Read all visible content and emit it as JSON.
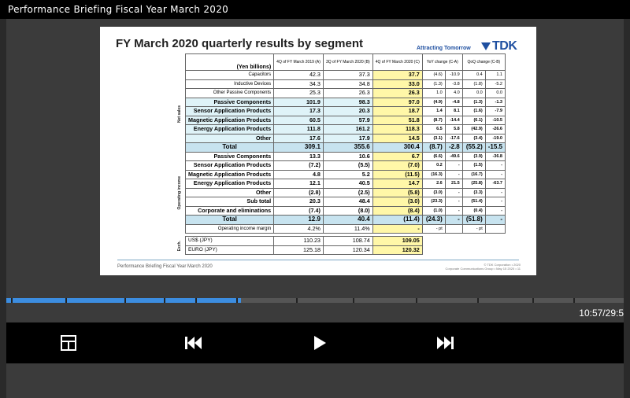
{
  "window": {
    "title": "Performance Briefing Fiscal Year March 2020"
  },
  "slide": {
    "title": "FY March 2020 quarterly results by segment",
    "tagline": "Attracting Tomorrow",
    "logo": "TDK",
    "footer_left": "Performance Briefing Fiscal Year March 2020",
    "footer_right_1": "© TDK Corporation • 2020",
    "footer_right_2": "Corporate Communications Group • May 15 2020 • 11",
    "section_net_sales": "Net sales",
    "section_operating_income": "Operating income",
    "section_fx": "Exch.",
    "table": {
      "unit": "(Yen billions)",
      "col_a": "4Q of FY March 2019 (A)",
      "col_b": "3Q of FY March 2020 (B)",
      "col_c": "4Q of FY March 2020 (C)",
      "yoy": "YoY change (C-A)",
      "qoq": "QoQ change (C-B)",
      "yen_billions": "Yen billions",
      "pct": "%",
      "rows": [
        {
          "label": "Capacitors",
          "a": "42.3",
          "b": "37.3",
          "c": "37.7",
          "yoy": "(4.6)",
          "yoy_pct": "-10.9",
          "qoq": "0.4",
          "qoq_pct": "1.1"
        },
        {
          "label": "Inductive Devices",
          "a": "34.3",
          "b": "34.8",
          "c": "33.0",
          "yoy": "(1.3)",
          "yoy_pct": "-3.8",
          "qoq": "(1.8)",
          "qoq_pct": "-5.2"
        },
        {
          "label": "Other Passive Components",
          "a": "25.3",
          "b": "26.3",
          "c": "26.3",
          "yoy": "1.0",
          "yoy_pct": "4.0",
          "qoq": "0.0",
          "qoq_pct": "0.0"
        },
        {
          "label": "Passive Components",
          "a": "101.9",
          "b": "98.3",
          "c": "97.0",
          "yoy": "(4.9)",
          "yoy_pct": "-4.8",
          "qoq": "(1.3)",
          "qoq_pct": "-1.3"
        },
        {
          "label": "Sensor Application Products",
          "a": "17.3",
          "b": "20.3",
          "c": "18.7",
          "yoy": "1.4",
          "yoy_pct": "8.1",
          "qoq": "(1.6)",
          "qoq_pct": "-7.9"
        },
        {
          "label": "Magnetic Application Products",
          "a": "60.5",
          "b": "57.9",
          "c": "51.8",
          "yoy": "(8.7)",
          "yoy_pct": "-14.4",
          "qoq": "(6.1)",
          "qoq_pct": "-10.5"
        },
        {
          "label": "Energy Application Products",
          "a": "111.8",
          "b": "161.2",
          "c": "118.3",
          "yoy": "6.5",
          "yoy_pct": "5.8",
          "qoq": "(42.9)",
          "qoq_pct": "-26.6"
        },
        {
          "label": "Other",
          "a": "17.6",
          "b": "17.9",
          "c": "14.5",
          "yoy": "(3.1)",
          "yoy_pct": "-17.6",
          "qoq": "(3.4)",
          "qoq_pct": "-19.0"
        },
        {
          "label": "Total",
          "a": "309.1",
          "b": "355.6",
          "c": "300.4",
          "yoy": "(8.7)",
          "yoy_pct": "-2.8",
          "qoq": "(55.2)",
          "qoq_pct": "-15.5"
        },
        {
          "label": "Passive Components",
          "a": "13.3",
          "b": "10.6",
          "c": "6.7",
          "yoy": "(6.6)",
          "yoy_pct": "-49.6",
          "qoq": "(3.9)",
          "qoq_pct": "-36.8"
        },
        {
          "label": "Sensor Application Products",
          "a": "(7.2)",
          "b": "(5.5)",
          "c": "(7.0)",
          "yoy": "0.2",
          "yoy_pct": "-",
          "qoq": "(1.5)",
          "qoq_pct": "-"
        },
        {
          "label": "Magnetic Application Products",
          "a": "4.8",
          "b": "5.2",
          "c": "(11.5)",
          "yoy": "(16.3)",
          "yoy_pct": "-",
          "qoq": "(16.7)",
          "qoq_pct": "-"
        },
        {
          "label": "Energy Application Products",
          "a": "12.1",
          "b": "40.5",
          "c": "14.7",
          "yoy": "2.6",
          "yoy_pct": "21.5",
          "qoq": "(25.8)",
          "qoq_pct": "-63.7"
        },
        {
          "label": "Other",
          "a": "(2.8)",
          "b": "(2.5)",
          "c": "(5.8)",
          "yoy": "(3.0)",
          "yoy_pct": "-",
          "qoq": "(3.3)",
          "qoq_pct": "-"
        },
        {
          "label": "Sub total",
          "a": "20.3",
          "b": "48.4",
          "c": "(3.0)",
          "yoy": "(23.3)",
          "yoy_pct": "-",
          "qoq": "(51.4)",
          "qoq_pct": "-"
        },
        {
          "label": "Corporate and eliminations",
          "a": "(7.4)",
          "b": "(8.0)",
          "c": "(8.4)",
          "yoy": "(1.0)",
          "yoy_pct": "-",
          "qoq": "(0.4)",
          "qoq_pct": "-"
        },
        {
          "label": "Total",
          "a": "12.9",
          "b": "40.4",
          "c": "(11.4)",
          "yoy": "(24.3)",
          "yoy_pct": "-",
          "qoq": "(51.8)",
          "qoq_pct": "-"
        },
        {
          "label": "Operating income margin",
          "a": "4.2%",
          "b": "11.4%",
          "c": "-",
          "yoy": "- pt",
          "yoy_pct": "",
          "qoq": "- pt",
          "qoq_pct": ""
        }
      ],
      "fx": [
        {
          "label": "US$ (JPY)",
          "a": "110.23",
          "b": "108.74",
          "c": "109.05"
        },
        {
          "label": "EURO (JPY)",
          "a": "125.18",
          "b": "120.34",
          "c": "120.32"
        }
      ]
    }
  },
  "player": {
    "time": "10:57/29:5",
    "progress_played": 0.38,
    "layout_icon": "layout-icon",
    "prev_icon": "skip-previous-icon",
    "play_icon": "play-icon",
    "next_icon": "skip-next-icon"
  }
}
